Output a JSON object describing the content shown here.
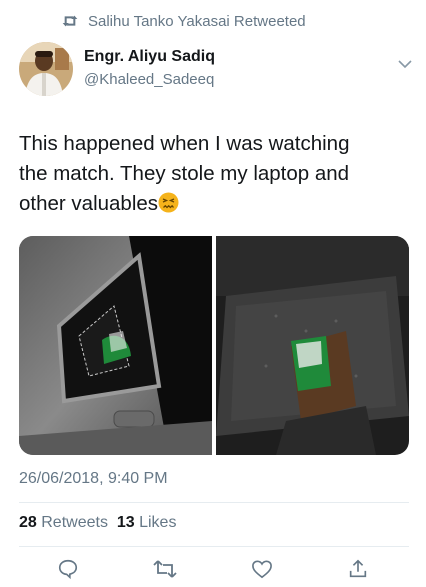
{
  "retweet_notice": "Salihu Tanko Yakasai Retweeted",
  "author": {
    "name": "Engr. Aliyu Sadiq",
    "handle": "@Khaleed_Sadeeq"
  },
  "tweet": {
    "text_lines": [
      "This happened when I was watching",
      "the match. They stole my laptop and",
      "other valuables"
    ],
    "emoji": "confounded-face-emoji"
  },
  "media": [
    {
      "icon": "car-window-broken-photo"
    },
    {
      "icon": "car-seat-glass-photo"
    }
  ],
  "timestamp": "26/06/2018, 9:40 PM",
  "stats": {
    "retweets_count": "28",
    "retweets_label": "Retweets",
    "likes_count": "13",
    "likes_label": "Likes"
  },
  "actions": [
    {
      "icon": "reply-icon"
    },
    {
      "icon": "retweet-icon"
    },
    {
      "icon": "like-icon"
    },
    {
      "icon": "share-icon"
    }
  ],
  "colors": {
    "text_primary": "#14171a",
    "text_secondary": "#657786",
    "divider": "#e6ecf0"
  }
}
